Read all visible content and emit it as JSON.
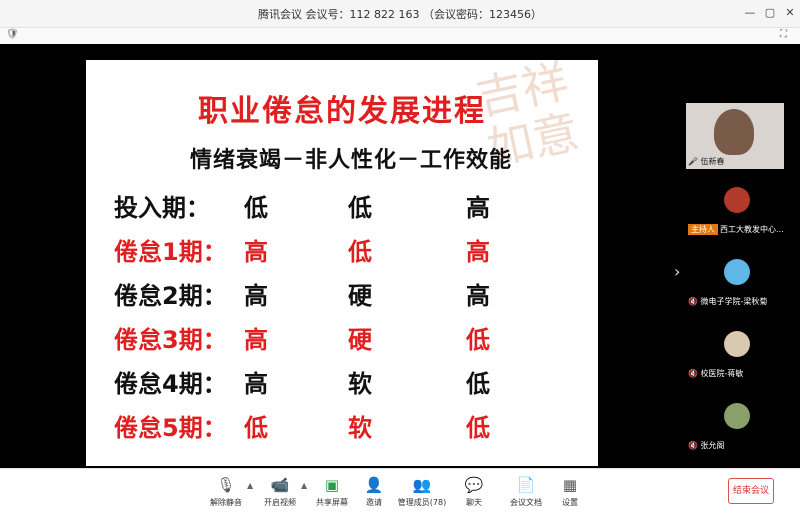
{
  "window": {
    "title": "腾讯会议 会议号：112 822 163 （会议密码：123456）",
    "min_glyph": "—",
    "max_glyph": "▢",
    "close_glyph": "✕"
  },
  "slide": {
    "title": "职业倦怠的发展进程",
    "subtitle": "情绪衰竭－非人性化－工作效能",
    "watermark": "吉祥如意",
    "rows": [
      {
        "label": "投入期：",
        "v1": "低",
        "v2": "低",
        "v3": "高",
        "color": "#111111"
      },
      {
        "label": "倦怠1期：",
        "v1": "高",
        "v2": "低",
        "v3": "高",
        "color": "#e02020"
      },
      {
        "label": "倦怠2期：",
        "v1": "高",
        "v2": "硬",
        "v3": "高",
        "color": "#111111"
      },
      {
        "label": "倦怠3期：",
        "v1": "高",
        "v2": "硬",
        "v3": "低",
        "color": "#e02020"
      },
      {
        "label": "倦怠4期：",
        "v1": "高",
        "v2": "软",
        "v3": "低",
        "color": "#111111"
      },
      {
        "label": "倦怠5期：",
        "v1": "低",
        "v2": "软",
        "v3": "低",
        "color": "#e02020"
      }
    ]
  },
  "participants": [
    {
      "name": "伍新春",
      "host": false
    },
    {
      "name": "西工大教发中心...",
      "host": true,
      "badge": "主持人"
    },
    {
      "name": "微电子学院-梁秋菊",
      "host": false
    },
    {
      "name": "校医院-蒋敏",
      "host": false
    },
    {
      "name": "张允阁",
      "host": false
    }
  ],
  "toolbar": {
    "unmute": "解除静音",
    "start_video": "开启视频",
    "share_screen": "共享屏幕",
    "invite": "邀请",
    "manage_members": "管理成员(78)",
    "chat": "聊天",
    "meeting_docs": "会议文档",
    "settings": "设置",
    "end_meeting": "结束会议"
  },
  "colors": {
    "accent_red": "#e02020",
    "host_badge": "#e07a10",
    "stage_bg": "#000000"
  }
}
